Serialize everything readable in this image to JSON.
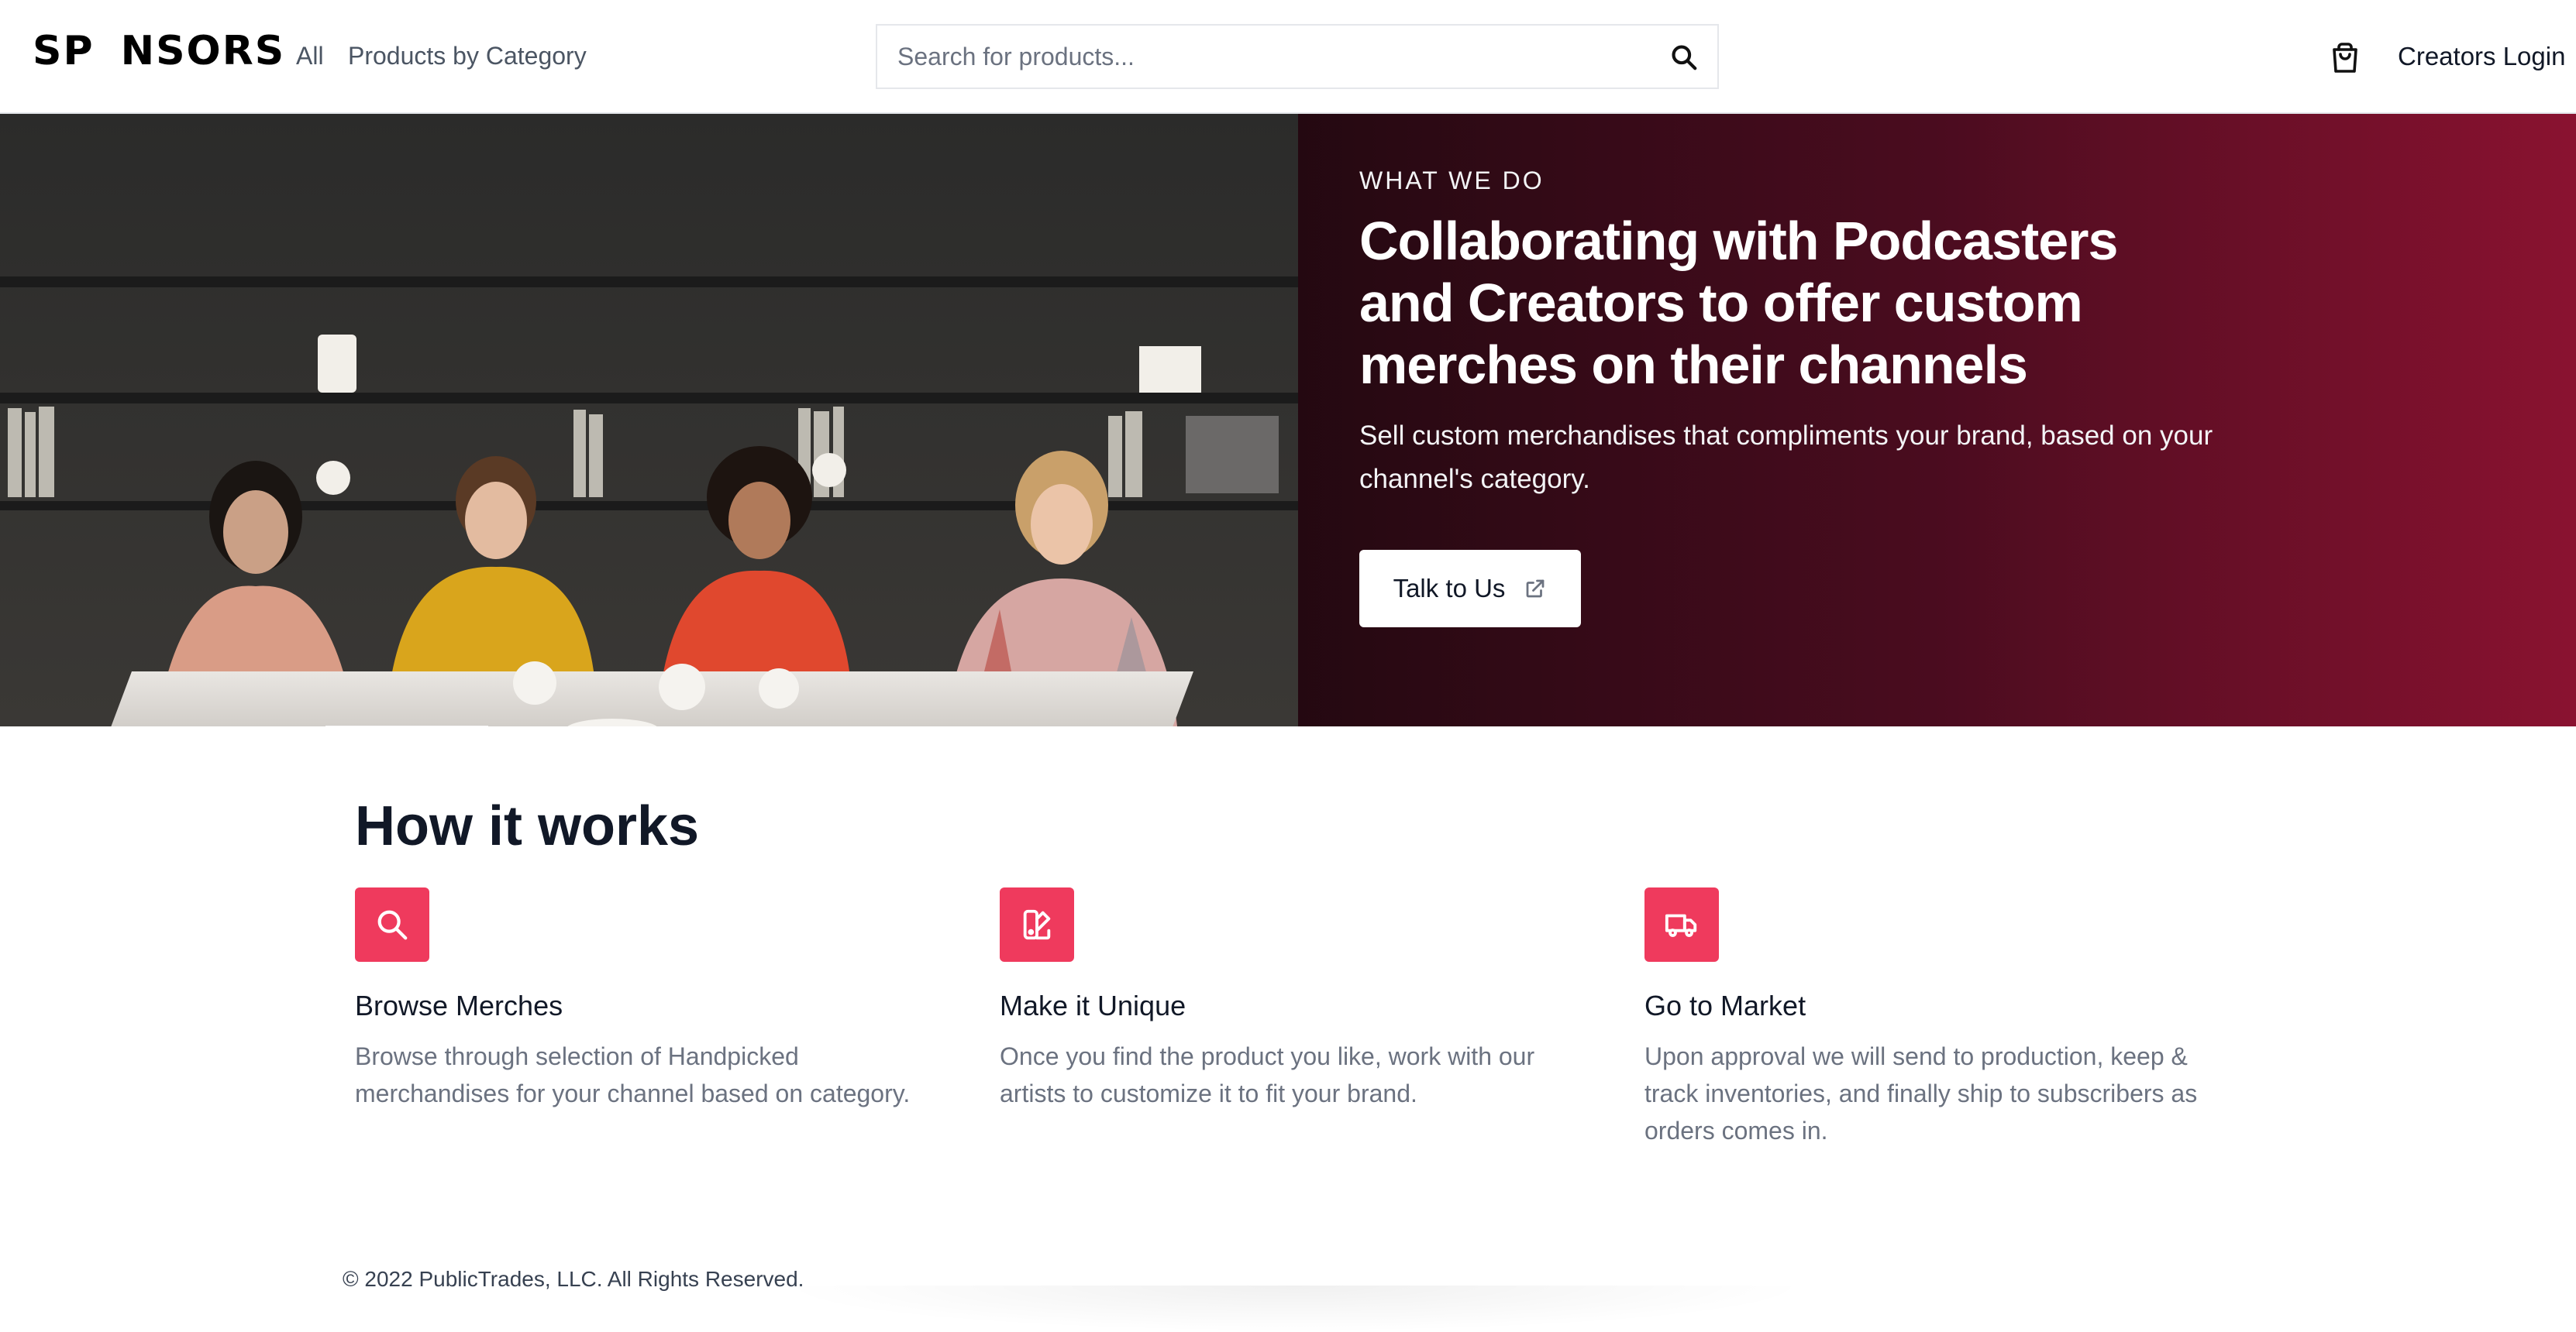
{
  "header": {
    "logo": {
      "part1": "SP",
      "part2": "NSORS"
    },
    "nav": {
      "all": "All",
      "by_category": "Products by Category"
    },
    "search": {
      "placeholder": "Search for products...",
      "icon": "search-icon"
    },
    "cart_icon": "shopping-bag-icon",
    "login": "Creators Login"
  },
  "hero": {
    "kicker": "WHAT WE DO",
    "title": "Collaborating with Podcasters and Creators to offer custom merches on their channels",
    "subtitle": "Sell custom merchandises that compliments your brand, based on your channel's category.",
    "cta": {
      "label": "Talk to Us",
      "icon": "external-link-icon"
    },
    "image_alt": "Four creators sitting around a marble table in a studio"
  },
  "how": {
    "title": "How it works",
    "steps": [
      {
        "icon": "search-icon",
        "title": "Browse Merches",
        "desc": "Browse through selection of Handpicked merchandises for your channel based on category."
      },
      {
        "icon": "swatch-icon",
        "title": "Make it Unique",
        "desc": "Once you find the product you like, work with our artists to customize it to fit your brand."
      },
      {
        "icon": "truck-icon",
        "title": "Go to Market",
        "desc": "Upon approval we will send to production, keep & track inventories, and finally ship to subscribers as orders comes in."
      }
    ]
  },
  "footer": {
    "copyright": "© 2022 PublicTrades, LLC. All Rights Reserved."
  },
  "colors": {
    "accent": "#ef3a5d",
    "hero_gradient_end": "#8a1230"
  }
}
